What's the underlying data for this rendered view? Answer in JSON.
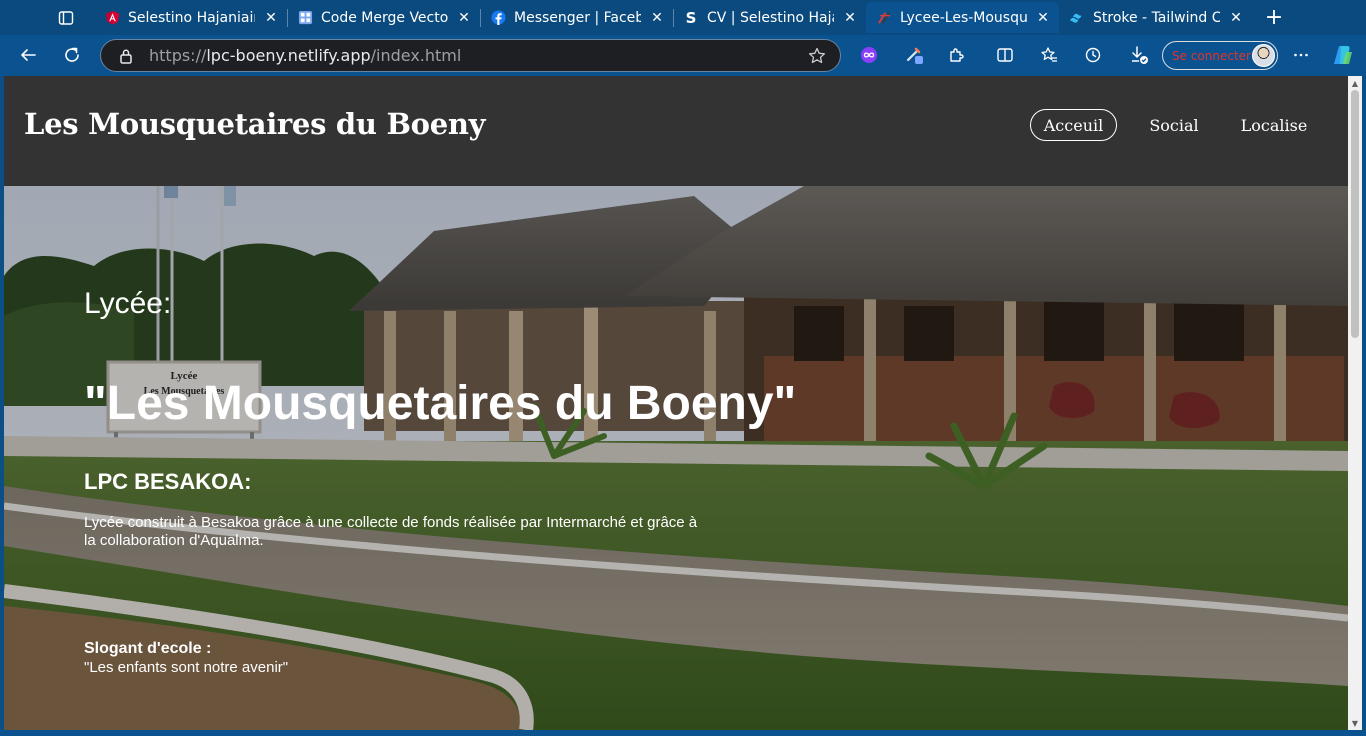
{
  "browser": {
    "tabs": [
      {
        "title": "Selestino Hajaniaina",
        "icon": "angular-logo-icon",
        "color": "#e23237"
      },
      {
        "title": "Code Merge Vector",
        "icon": "repo-logo-icon",
        "color": "#4c8bf5"
      },
      {
        "title": "Messenger | Facebook",
        "icon": "facebook-logo-icon",
        "color": "#1877f2"
      },
      {
        "title": "CV | Selestino Hajaniaina",
        "icon": "s-logo-icon",
        "color": "#ffffff"
      },
      {
        "title": "Lycee-Les-Mousquetaires",
        "icon": "netlify-logo-icon",
        "color": "#c0392b",
        "active": true
      },
      {
        "title": "Stroke - Tailwind CSS",
        "icon": "tailwind-logo-icon",
        "color": "#38bdf8"
      }
    ],
    "url_scheme": "https://",
    "url_host": "lpc-boeny.netlify.app",
    "url_path": "/index.html",
    "signin_label": "Se connecter"
  },
  "site": {
    "title": "Les Mousquetaires du Boeny",
    "nav": [
      "Acceuil",
      "Social",
      "Localise"
    ]
  },
  "hero": {
    "label": "Lycée:",
    "name": "\"Les Mousquetaires du Boeny\"",
    "subtitle": "LPC BESAKOA:",
    "description": "Lycée construit à Besakoa grâce à une collecte de fonds réalisée par Intermarché et grâce à la collaboration d'Aqualma.",
    "slogan_label": "Slogant d'ecole :",
    "slogan": "\"Les enfants sont notre avenir\"",
    "sign_text": [
      "Lycée",
      "Les Mousquetaires"
    ]
  },
  "colors": {
    "browser_frame": "#0b5290",
    "header_bg": "#333333",
    "signin_text": "#e0342c"
  }
}
